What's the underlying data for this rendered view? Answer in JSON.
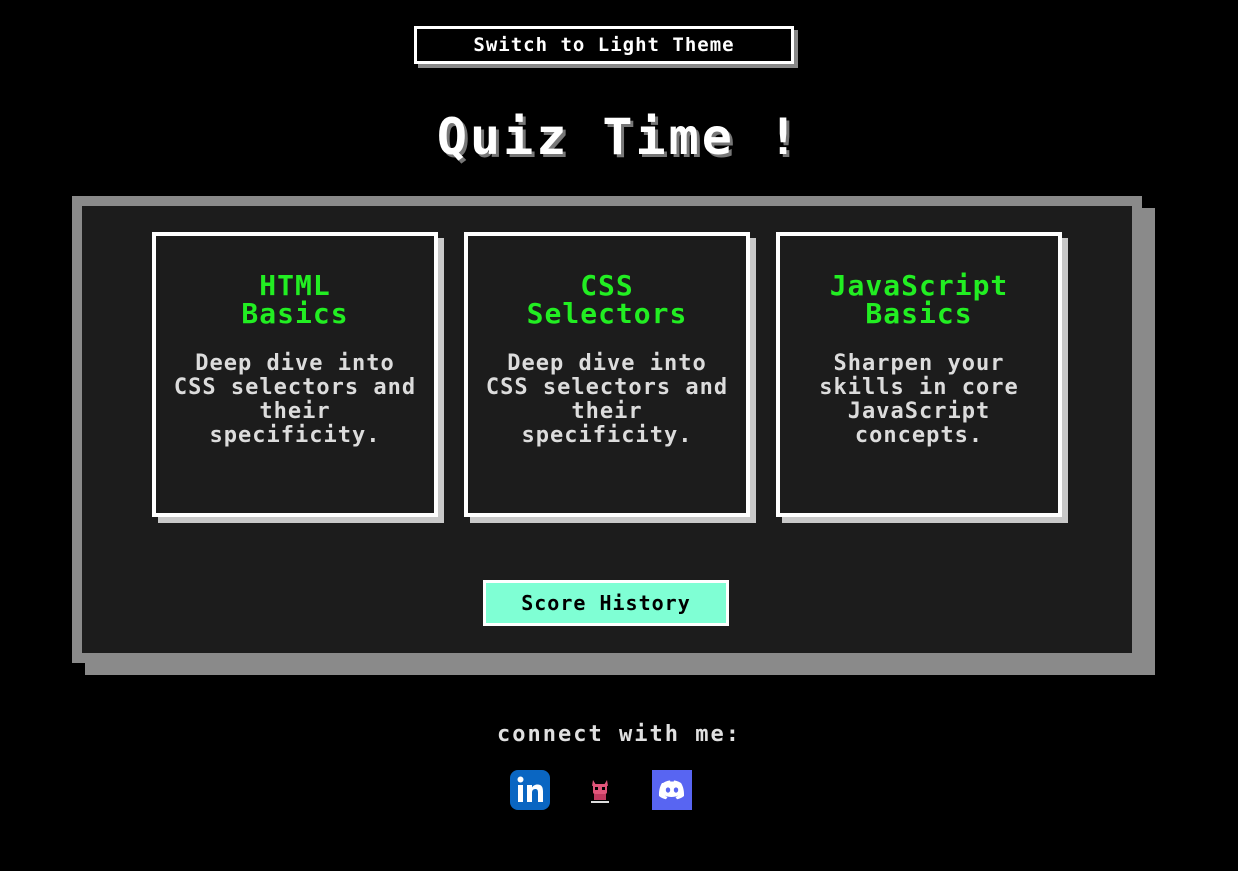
{
  "header": {
    "theme_toggle_label": "Switch to Light Theme",
    "title": "Quiz Time !"
  },
  "quizzes": [
    {
      "title_line1": "HTML",
      "title_line2": "Basics",
      "description": "Deep dive into CSS selectors and their specificity."
    },
    {
      "title_line1": "CSS",
      "title_line2": "Selectors",
      "description": "Deep dive into CSS selectors and their specificity."
    },
    {
      "title_line1": "JavaScript",
      "title_line2": "Basics",
      "description": "Sharpen your skills in core JavaScript concepts."
    }
  ],
  "score_history_label": "Score History",
  "footer": {
    "connect_label": "connect with me:",
    "links": [
      {
        "icon": "linkedin-icon"
      },
      {
        "icon": "mascot-icon"
      },
      {
        "icon": "discord-icon"
      }
    ]
  },
  "colors": {
    "background": "#000000",
    "panel": "#1c1c1c",
    "panel_border": "#8a8a8a",
    "card_title": "#22ee22",
    "score_button": "#7fffd4",
    "linkedin": "#0a66c2",
    "discord": "#5865f2"
  }
}
